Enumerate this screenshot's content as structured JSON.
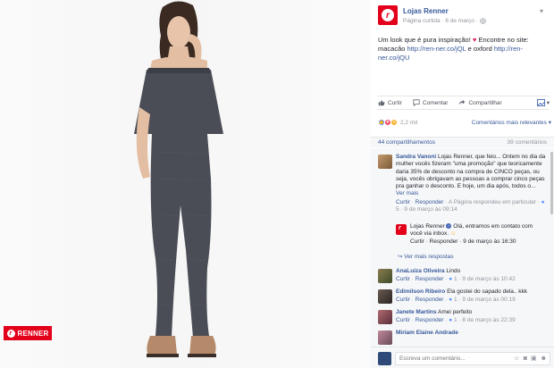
{
  "brand": {
    "badge_label": "RENNER",
    "accent": "#e3001b"
  },
  "post": {
    "page_name": "Lojas Renner",
    "meta_prefix": "Página curtida · 8 de março ·",
    "text_intro": "Um look que é pura inspiração!",
    "text_find": "Encontre no site: macacão",
    "link1": "http://ren-ner.co/jQL",
    "text_and": "e oxford",
    "link2": "http://ren-ner.co/jQU",
    "globe_icon": "globe-icon"
  },
  "actions": {
    "like": "Curtir",
    "comment": "Comentar",
    "share": "Compartilhar"
  },
  "reactions": {
    "count": "2,2 mil",
    "relevance": "Comentários mais relevantes ▾"
  },
  "stats": {
    "shares": "44 compartilhamentos",
    "comments": "39 comentários"
  },
  "comments": [
    {
      "name": "Sandra Vanoni",
      "text": "Lojas Renner, que feio... Ontem no dia da mulher vocês fizeram \"uma promoção\" que teoricamente daria 35% de desconto na compra de CINCO peças, ou seja, vocês obrigavam as pessoas a comprar cinco peças pra ganhar o desconto. E hoje, um dia após, todos o...",
      "see_more": "Ver mais",
      "like": "Curtir",
      "reply": "Responder",
      "footer_rest": "· A Página respondeu em particular ·",
      "count": "5",
      "time": "9 de março às 09:14"
    },
    {
      "name": "Lojas Renner",
      "text": "Olá, entramos em contato com você via inbox.",
      "like": "Curtir",
      "reply": "Responder",
      "time": "9 de março às 16:30"
    },
    {
      "more": "Ver mais respostas"
    },
    {
      "name": "AnaLuiza Oliveira",
      "text": "Lindo",
      "like": "Curtir",
      "reply": "Responder",
      "count": "1",
      "time": "9 de março às 10:42"
    },
    {
      "name": "Edimilson Ribeiro",
      "text": "Ela gostei do sapado dela.. kkk",
      "like": "Curtir",
      "reply": "Responder",
      "count": "1",
      "time": "9 de março às 00:19"
    },
    {
      "name": "Janete Martins",
      "text": "Amei perfeito",
      "like": "Curtir",
      "reply": "Responder",
      "count": "1",
      "time": "8 de março às 22:39"
    },
    {
      "name": "Miriam Elaine Andrade",
      "text": ""
    }
  ],
  "compose": {
    "placeholder": "Escreva um comentário..."
  }
}
